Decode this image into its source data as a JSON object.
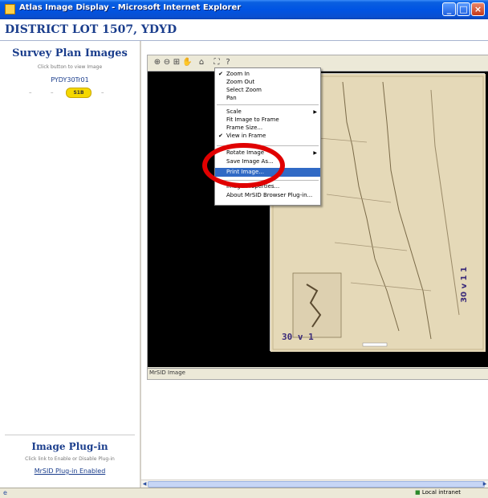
{
  "window": {
    "title": "Atlas Image Display - Microsoft Internet Explorer",
    "minimize": "_",
    "maximize": "□",
    "close": "×"
  },
  "header": {
    "title": "DISTRICT LOT 1507, YDYD"
  },
  "left_panel": {
    "section_title": "Survey Plan Images",
    "instruction": "Click button to view Image",
    "image_id": "PYDY30Tr01",
    "page_pill": "S1B",
    "plugin_title": "Image Plug-in",
    "plugin_instruction": "Click link to Enable or Disable Plug-in",
    "plugin_link": "MrSID Plug-in Enabled"
  },
  "viewer": {
    "toolbar_icons": [
      "zoom-in-icon",
      "zoom-out-icon",
      "select-zoom-icon",
      "pan-icon",
      "home-icon",
      "fit-icon",
      "help-icon"
    ],
    "status_text": "MrSID Image"
  },
  "context_menu": {
    "items": [
      {
        "label": "Zoom In",
        "checked": true
      },
      {
        "label": "Zoom Out"
      },
      {
        "label": "Select Zoom"
      },
      {
        "label": "Pan"
      },
      {
        "label": "Scale",
        "submenu": true
      },
      {
        "label": "Fit Image to Frame"
      },
      {
        "label": "Frame Size..."
      },
      {
        "label": "View in Frame",
        "checked": true
      },
      {
        "label": "Rotate Image",
        "submenu": true
      },
      {
        "label": "Save Image As..."
      },
      {
        "label": "Print Image...",
        "highlighted": true
      },
      {
        "label": "Image Properties..."
      },
      {
        "label": "About MrSID Browser Plug-in..."
      }
    ]
  },
  "map_labels": {
    "stamp": "30 v 1",
    "vertical": "30 v 1 1"
  },
  "statusbar": {
    "zone": "Local intranet"
  },
  "colors": {
    "accent": "#1a3d8c",
    "highlight": "#316ac5",
    "annotation": "#e00000"
  }
}
